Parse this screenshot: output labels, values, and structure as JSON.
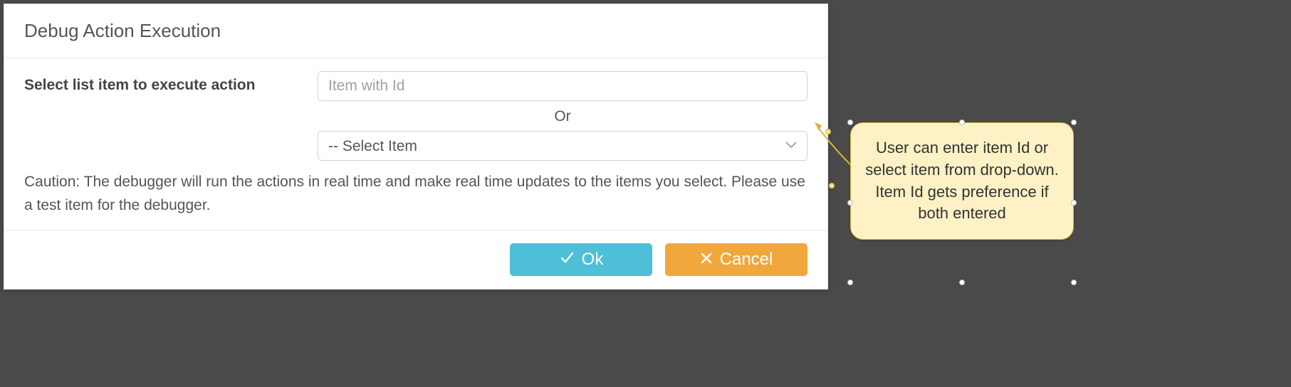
{
  "dialog": {
    "title": "Debug Action Execution",
    "form": {
      "label": "Select list item to execute action",
      "item_id_placeholder": "Item with Id",
      "or_text": "Or",
      "select_placeholder": "-- Select Item"
    },
    "caution": "Caution: The debugger will run the actions in real time and make real time updates to the items you select. Please use a test item for the debugger.",
    "buttons": {
      "ok": "Ok",
      "cancel": "Cancel"
    }
  },
  "callout": {
    "text": "User can enter item Id or select item from drop-down. Item Id gets preference if both entered"
  },
  "colors": {
    "ok_button": "#4dc0d7",
    "cancel_button": "#f0a83c",
    "callout_bg": "#fdf1c5",
    "callout_border": "#d8b63a"
  }
}
